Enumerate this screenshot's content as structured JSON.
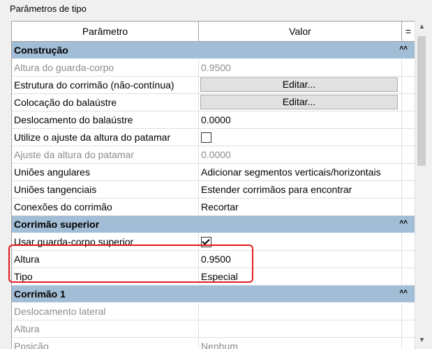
{
  "panel": {
    "title": "Parâmetros de tipo"
  },
  "table": {
    "headers": {
      "param": "Parâmetro",
      "valor": "Valor",
      "eq": "="
    },
    "sections": [
      {
        "label": "Construção",
        "rows": [
          {
            "param": "Altura do guarda-corpo",
            "value": "0.9500",
            "kind": "text",
            "disabled": true
          },
          {
            "param": "Estrutura do corrimão (não-contínua)",
            "value": "Editar...",
            "kind": "button",
            "disabled": false
          },
          {
            "param": "Colocação do balaústre",
            "value": "Editar...",
            "kind": "button",
            "disabled": false
          },
          {
            "param": "Deslocamento do balaústre",
            "value": "0.0000",
            "kind": "text",
            "disabled": false
          },
          {
            "param": "Utilize o ajuste da altura do patamar",
            "value": "",
            "kind": "checkbox",
            "checked": false,
            "disabled": false
          },
          {
            "param": "Ajuste da altura do patamar",
            "value": "0.0000",
            "kind": "text",
            "disabled": true
          },
          {
            "param": "Uniões angulares",
            "value": "Adicionar segmentos verticais/horizontais",
            "kind": "text",
            "disabled": false
          },
          {
            "param": "Uniões tangenciais",
            "value": "Estender corrimãos para encontrar",
            "kind": "text",
            "disabled": false
          },
          {
            "param": "Conexões do corrimão",
            "value": "Recortar",
            "kind": "text",
            "disabled": false
          }
        ]
      },
      {
        "label": "Corrimão superior",
        "rows": [
          {
            "param": "Usar guarda-corpo superior",
            "value": "",
            "kind": "checkbox",
            "checked": true,
            "disabled": false
          },
          {
            "param": "Altura",
            "value": "0.9500",
            "kind": "text",
            "disabled": false
          },
          {
            "param": "Tipo",
            "value": "Especial",
            "kind": "text",
            "disabled": false
          }
        ]
      },
      {
        "label": "Corrimão 1",
        "rows": [
          {
            "param": "Deslocamento lateral",
            "value": "",
            "kind": "text",
            "disabled": true
          },
          {
            "param": "Altura",
            "value": "",
            "kind": "text",
            "disabled": true
          },
          {
            "param": "Posição",
            "value": "Nenhum",
            "kind": "text",
            "disabled": true
          }
        ]
      }
    ]
  },
  "colors": {
    "section_bg": "#a2bdd6",
    "highlight": "#e21c1c",
    "disabled_text": "#8c8c8c"
  }
}
